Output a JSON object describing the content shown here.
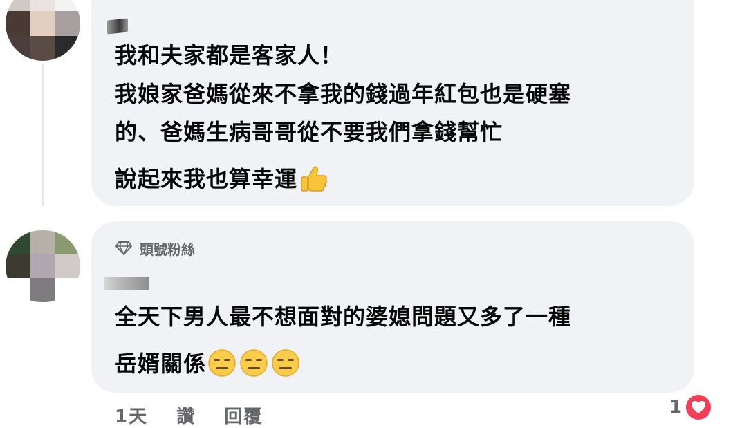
{
  "comment1": {
    "lines": [
      "我和夫家都是客家人！",
      "我娘家爸媽從來不拿我的錢過年紅包也是硬塞",
      "的、爸媽生病哥哥從不要我們拿錢幫忙",
      "說起來我也算幸運"
    ],
    "emoji": "thumbs-up"
  },
  "comment2": {
    "badge_icon": "diamond-icon",
    "badge_label": "頭號粉絲",
    "lines": [
      "全天下男人最不想面對的婆媳問題又多了一種",
      "岳婿關係"
    ],
    "emoji": [
      "expressionless-face",
      "expressionless-face",
      "expressionless-face"
    ]
  },
  "footer": {
    "time": "1天",
    "like": "讚",
    "reply": "回覆",
    "reaction_count": "1",
    "reaction_icon": "heart-icon",
    "reaction_color": "#f33e58"
  },
  "colors": {
    "bubble": "#f0f2f5",
    "secondary_text": "#65676b"
  }
}
